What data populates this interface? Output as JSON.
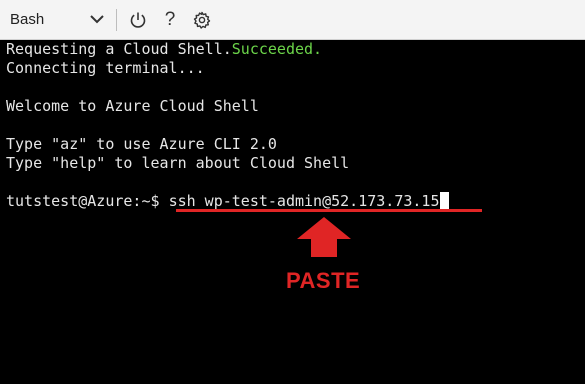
{
  "toolbar": {
    "shell_type": "Bash",
    "icons": [
      "chevron-down-icon",
      "power-icon",
      "help-icon",
      "settings-gear-icon"
    ],
    "help_glyph": "?"
  },
  "terminal": {
    "line1_text": "Requesting a Cloud Shell.",
    "line1_status": "Succeeded.",
    "line2": "Connecting terminal...",
    "line3": "Welcome to Azure Cloud Shell",
    "line4": "Type \"az\" to use Azure CLI 2.0",
    "line5": "Type \"help\" to learn about Cloud Shell",
    "prompt": "tutstest@Azure:~$ ",
    "command": "ssh wp-test-admin@52.173.73.15"
  },
  "annotation": {
    "label": "PASTE",
    "color": "#e02525"
  },
  "colors": {
    "terminal_bg": "#000000",
    "terminal_fg": "#e6e6e6",
    "success": "#6cd54a",
    "toolbar_bg": "#f4f4f4"
  }
}
